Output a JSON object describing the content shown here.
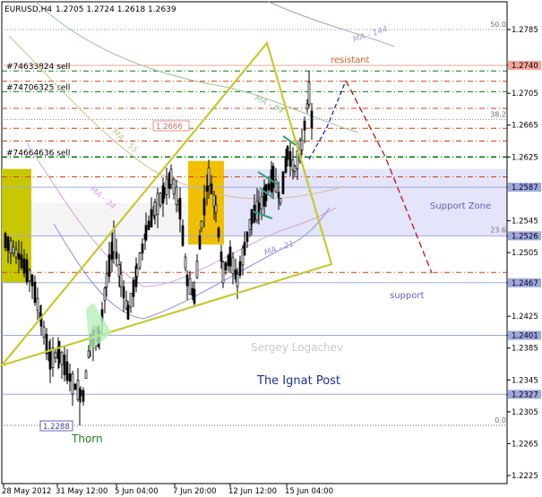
{
  "header": {
    "symbol": "EURUSD,H4",
    "quote": "1.2705 1.2724 1.2618 1.2639"
  },
  "chart_data": {
    "type": "candlestick",
    "symbol": "EURUSD",
    "timeframe": "H4",
    "ohlc_last": {
      "open": 1.2705,
      "high": 1.2724,
      "low": 1.2618,
      "close": 1.2639
    },
    "ylim": [
      1.222,
      1.281
    ],
    "y_ticks": [
      "1.2785",
      "1.2740",
      "1.2705",
      "1.2665",
      "1.2625",
      "1.2587",
      "1.2545",
      "1.2526",
      "1.2505",
      "1.2467",
      "1.2425",
      "1.2401",
      "1.2385",
      "1.2345",
      "1.2327",
      "1.2305",
      "1.2265",
      "1.2225"
    ],
    "x_ticks": [
      "28 May 2012",
      "31 May 12:00",
      "5 Jun 04:00",
      "7 Jun 20:00",
      "12 Jun 12:00",
      "15 Jun 04:00"
    ],
    "price_boxes": [
      {
        "label": "1.2740",
        "value": 1.274,
        "color": "#f4a49a"
      },
      {
        "label": "1.2587",
        "value": 1.2587,
        "color": "#a0a8e0"
      },
      {
        "label": "1.2526",
        "value": 1.2526,
        "color": "#a0a8e0"
      },
      {
        "label": "1.2467",
        "value": 1.2467,
        "color": "#a0a8e0"
      },
      {
        "label": "1.2401",
        "value": 1.2401,
        "color": "#a0a8e0"
      },
      {
        "label": "1.2327",
        "value": 1.2327,
        "color": "#a0a8e0"
      }
    ],
    "orders": [
      {
        "label": "#74633824 sell",
        "value": 1.2733
      },
      {
        "label": "#74706325 sell",
        "value": 1.2707
      },
      {
        "label": "#74664636 sell",
        "value": 1.2625
      }
    ],
    "fibo_levels": [
      {
        "label": "50.0",
        "value": 1.2785
      },
      {
        "label": "38.2",
        "value": 1.2672
      },
      {
        "label": "23.6",
        "value": 1.2527
      },
      {
        "label": "0.0",
        "value": 1.2288
      }
    ],
    "moving_averages": [
      {
        "label": "MA - 144",
        "color": "#a0a0c8"
      },
      {
        "label": "MA - 89",
        "color": "#9cc49c"
      },
      {
        "label": "MA - 55",
        "color": "#d0c090"
      },
      {
        "label": "MA - 34",
        "color": "#d8a0d8"
      },
      {
        "label": "MA - 21",
        "color": "#9090e0"
      }
    ],
    "annotations": {
      "resistant": "resistant",
      "support_zone": "Support Zone",
      "support": "support",
      "thorn": "Thorn",
      "author": "Sergey Logachev",
      "brand": "The Ignat Post",
      "low_box": "1.2288",
      "box_mid": "1.2666"
    },
    "colors": {
      "candle": "#000000",
      "triangle": "#c8c832",
      "yellow_box": "#f0c000",
      "olive_box": "#c8c800",
      "support_zone_fill": "#e4e4fa",
      "orders_line": "#008000",
      "resistance_line": "#d04010",
      "forecast_blue": "#1010c0",
      "forecast_red": "#c00000"
    }
  }
}
